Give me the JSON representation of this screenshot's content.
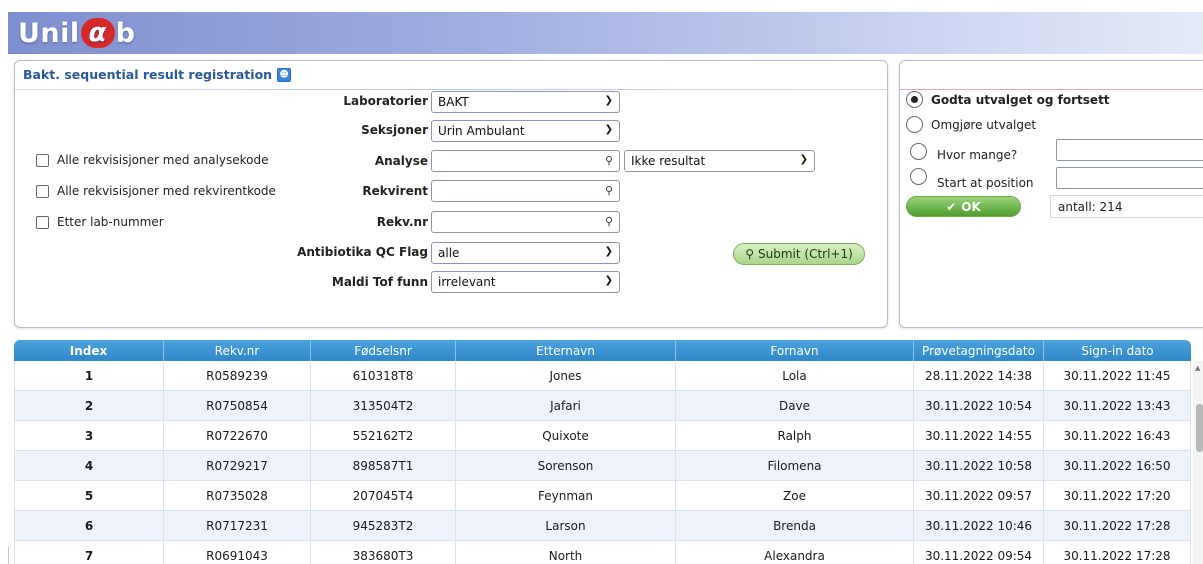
{
  "app": {
    "logo_text_pre": "Unil",
    "logo_alpha": "α",
    "logo_text_post": "b"
  },
  "panel": {
    "title": "Bakt. sequential result registration",
    "title_icon": "user-icon"
  },
  "form": {
    "laboratorier": {
      "label": "Laboratorier",
      "value": "BAKT"
    },
    "seksjoner": {
      "label": "Seksjoner",
      "value": "Urin Ambulant"
    },
    "analyse": {
      "label": "Analyse",
      "value": "",
      "filter_value": "Ikke resultat"
    },
    "rekvirent": {
      "label": "Rekvirent",
      "value": ""
    },
    "rekvnr": {
      "label": "Rekv.nr",
      "value": ""
    },
    "antibiotika": {
      "label": "Antibiotika QC Flag",
      "value": "alle"
    },
    "maldi": {
      "label": "Maldi Tof funn",
      "value": "irrelevant"
    },
    "submit_label": "Submit (Ctrl+1)"
  },
  "checkboxes": [
    {
      "label": "Alle rekvisisjoner med analysekode",
      "checked": false
    },
    {
      "label": "Alle rekvisisjoner med rekvirentkode",
      "checked": false
    },
    {
      "label": "Etter lab-nummer",
      "checked": false
    }
  ],
  "selection": {
    "godta_label": "Godta utvalget og fortsett",
    "omgjore_label": "Omgjøre utvalget",
    "hvor_mange_label": "Hvor mange?",
    "start_label": "Start at position",
    "hvor_mange_value": "",
    "start_value": "",
    "ok_label": "OK",
    "antall_text": "antall: 214"
  },
  "table": {
    "columns": [
      "Index",
      "Rekv.nr",
      "Fødselsnr",
      "Etternavn",
      "Fornavn",
      "Prøvetagningsdato",
      "Sign-in dato"
    ],
    "rows": [
      [
        "1",
        "R0589239",
        "610318T8",
        "Jones",
        "Lola",
        "28.11.2022 14:38",
        "30.11.2022 11:45"
      ],
      [
        "2",
        "R0750854",
        "313504T2",
        "Jafari",
        "Dave",
        "30.11.2022 10:54",
        "30.11.2022 13:43"
      ],
      [
        "3",
        "R0722670",
        "552162T2",
        "Quixote",
        "Ralph",
        "30.11.2022 14:55",
        "30.11.2022 16:43"
      ],
      [
        "4",
        "R0729217",
        "898587T1",
        "Sorenson",
        "Filomena",
        "30.11.2022 10:58",
        "30.11.2022 16:50"
      ],
      [
        "5",
        "R0735028",
        "207045T4",
        "Feynman",
        "Zoe",
        "30.11.2022 09:57",
        "30.11.2022 17:20"
      ],
      [
        "6",
        "R0717231",
        "945283T2",
        "Larson",
        "Brenda",
        "30.11.2022 10:46",
        "30.11.2022 17:28"
      ],
      [
        "7",
        "R0691043",
        "383680T3",
        "North",
        "Alexandra",
        "30.11.2022 09:54",
        "30.11.2022 17:28"
      ]
    ]
  }
}
